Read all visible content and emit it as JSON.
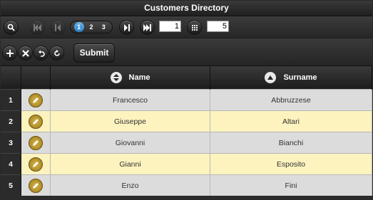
{
  "window": {
    "title": "Customers Directory"
  },
  "pager": {
    "pages": [
      "1",
      "2",
      "3"
    ],
    "current_page": "1",
    "page_input_value": "1",
    "rows_per_page_value": "5"
  },
  "toolbar": {
    "submit_label": "Submit"
  },
  "table": {
    "columns": [
      {
        "label": "Name",
        "sort": "both"
      },
      {
        "label": "Surname",
        "sort": "ascending"
      }
    ],
    "rows": [
      {
        "num": "1",
        "name": "Francesco",
        "surname": "Abbruzzese"
      },
      {
        "num": "2",
        "name": "Giuseppe",
        "surname": "Altari"
      },
      {
        "num": "3",
        "name": "Giovanni",
        "surname": "Bianchi"
      },
      {
        "num": "4",
        "name": "Gianni",
        "surname": "Esposito"
      },
      {
        "num": "5",
        "name": "Enzo",
        "surname": "Fini"
      }
    ]
  },
  "colors": {
    "row_odd": "#dcdcdc",
    "row_even": "#fdf3bf",
    "active_page": "#2b80c6",
    "edit_icon": "#c9a437"
  }
}
